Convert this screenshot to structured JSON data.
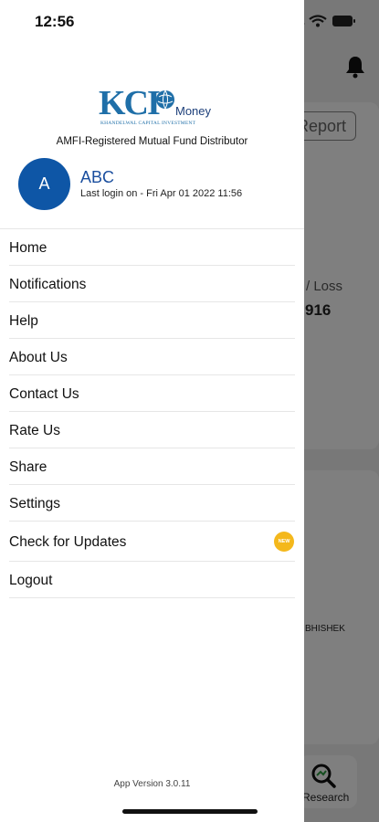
{
  "status_bar": {
    "time": "12:56"
  },
  "background": {
    "report_label": "Report",
    "loss_label": "/ Loss",
    "value_fragment": "916",
    "name_fragment": "BHISHEK",
    "research_label": "Research"
  },
  "drawer": {
    "logo": {
      "letters": "KCI",
      "suffix": "Money",
      "tagline": "KHANDELWAL CAPITAL INVESTMENT"
    },
    "distributor_text": "AMFI-Registered Mutual Fund Distributor",
    "user": {
      "avatar_initial": "A",
      "name": "ABC",
      "last_login": "Last login on - Fri Apr 01 2022 11:56"
    },
    "menu_items": [
      {
        "label": "Home"
      },
      {
        "label": "Notifications"
      },
      {
        "label": "Help"
      },
      {
        "label": "About Us"
      },
      {
        "label": "Contact Us"
      },
      {
        "label": "Rate Us"
      },
      {
        "label": "Share"
      },
      {
        "label": "Settings"
      },
      {
        "label": "Check for Updates",
        "badge": "NEW"
      },
      {
        "label": "Logout"
      }
    ],
    "app_version": "App Version 3.0.11"
  },
  "colors": {
    "brand_blue": "#1f6fa8",
    "avatar_blue": "#0e56a6",
    "badge_yellow": "#f4b81c"
  }
}
